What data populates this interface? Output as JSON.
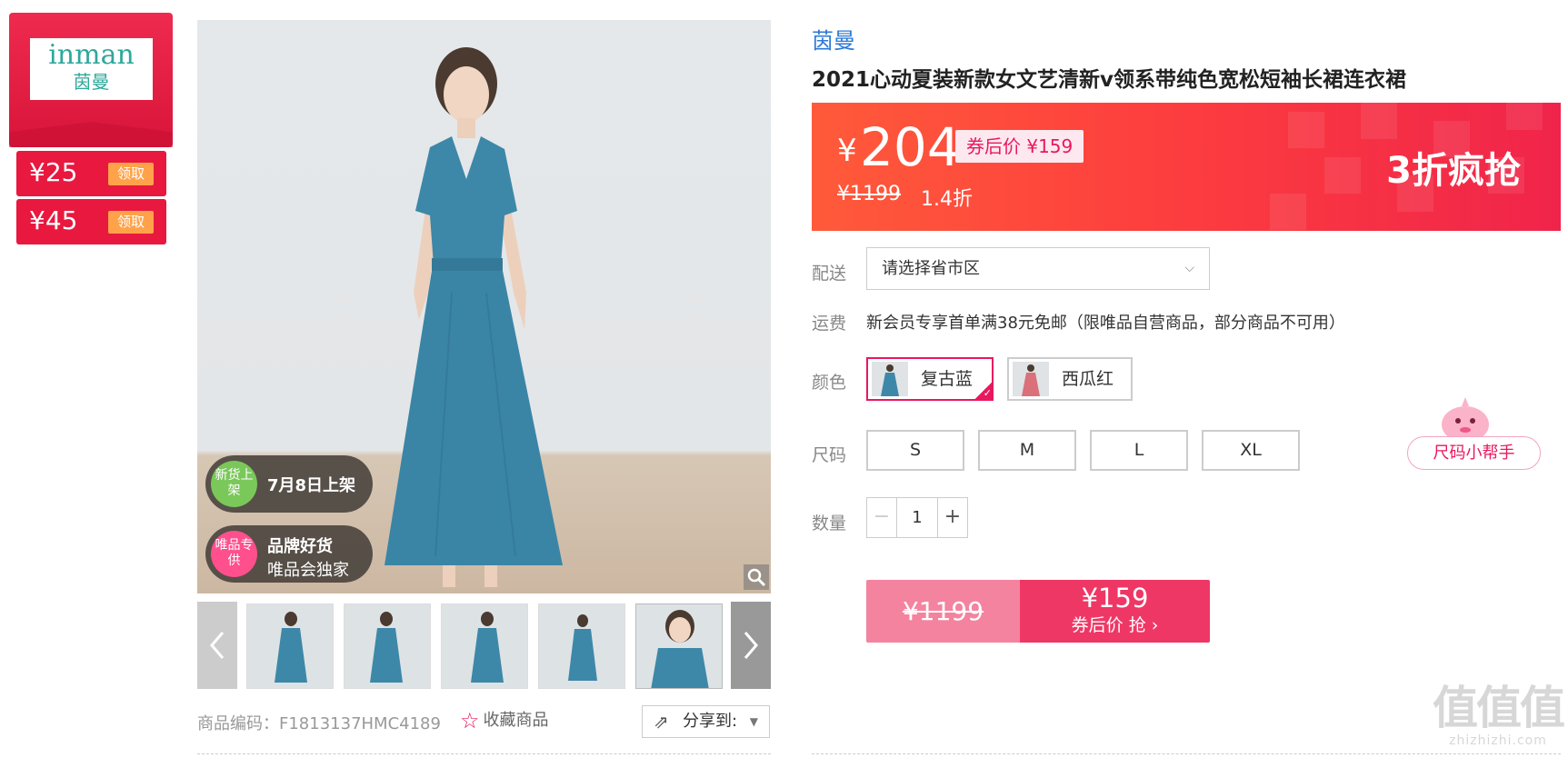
{
  "sidebar": {
    "logo_en": "inman",
    "logo_cn": "茵曼",
    "coupons": [
      {
        "amount": "¥25",
        "action": "领取"
      },
      {
        "amount": "¥45",
        "action": "领取"
      }
    ]
  },
  "gallery": {
    "tags": [
      {
        "badge": "新货上架",
        "line1": "7月8日上架",
        "line2": ""
      },
      {
        "badge": "唯品专供",
        "line1": "品牌好货",
        "line2": "唯品会独家"
      }
    ],
    "product_code_label": "商品编码：",
    "product_code": "F1813137HMC4189",
    "favorite_label": "收藏商品",
    "share_label": "分享到:"
  },
  "product": {
    "brand": "茵曼",
    "title": "2021心动夏装新款女文艺清新v领系带纯色宽松短袖长裙连衣裙"
  },
  "price": {
    "currency": "¥",
    "current": "204",
    "after_coupon": "券后价 ¥159",
    "original": "¥1199",
    "discount": "1.4折",
    "slogan": "3折疯抢"
  },
  "delivery": {
    "label": "配送",
    "placeholder": "请选择省市区"
  },
  "shipping": {
    "label": "运费",
    "text": "新会员专享首单满38元免邮（限唯品自营商品，部分商品不可用）"
  },
  "colors": {
    "label": "颜色",
    "options": [
      {
        "name": "复古蓝",
        "selected": true,
        "swatch": "#3d88a8"
      },
      {
        "name": "西瓜红",
        "selected": false,
        "swatch": "#d9707a"
      }
    ]
  },
  "sizes": {
    "label": "尺码",
    "options": [
      "S",
      "M",
      "L",
      "XL"
    ],
    "helper": "尺码小帮手"
  },
  "quantity": {
    "label": "数量",
    "value": "1"
  },
  "buy_button": {
    "original": "¥1199",
    "price": "¥159",
    "action": "券后价 抢 ›"
  },
  "watermark": {
    "big": "值值值",
    "small": "zhizhizhi.com"
  },
  "colors_theme": {
    "accent": "#e8185f",
    "banner": "#fd3f3e",
    "brand_link": "#2d7ad6"
  }
}
